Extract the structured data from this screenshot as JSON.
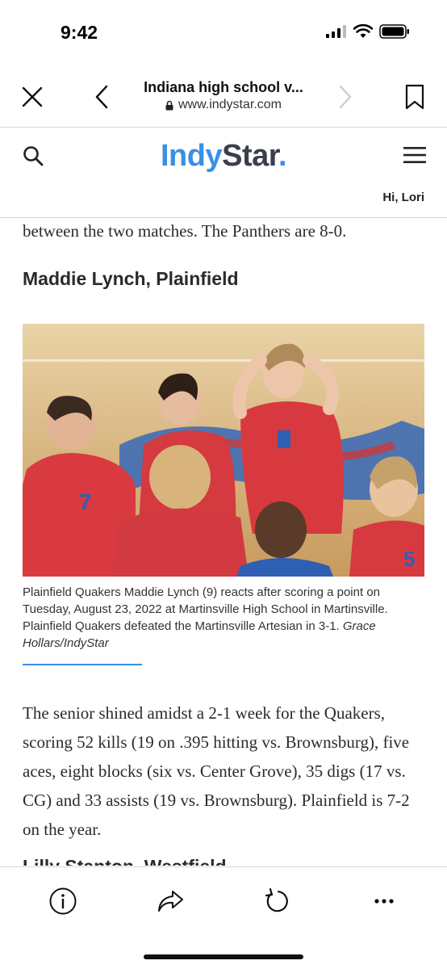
{
  "status": {
    "time": "9:42"
  },
  "browser": {
    "page_title": "Indiana high school v...",
    "host": "www.indystar.com",
    "icons": [
      "close-icon",
      "back-chevron-icon",
      "forward-chevron-icon",
      "bookmark-icon",
      "lock-icon"
    ]
  },
  "site": {
    "logo_part1": "Indy",
    "logo_part2": "Star",
    "logo_dot": ".",
    "greeting": "Hi, Lori",
    "colors": {
      "brand_blue": "#3a8fe6",
      "brand_dark": "#3a3f4a"
    }
  },
  "article": {
    "top_paragraph": "between the two matches. The Panthers are 8-0.",
    "subhead": "Maddie Lynch, Plainfield",
    "caption": "Plainfield Quakers Maddie Lynch (9) reacts after scoring a point on Tuesday, August 23, 2022 at Martinsville High School in Martinsville. Plainfield Quakers defeated the Martinsville Artesian in 3-1.",
    "credit": "Grace Hollars/IndyStar",
    "body_paragraph": "The senior shined amidst a 2-1 week for the Quakers, scoring 52 kills (19 on .395 hitting vs. Brownsburg), five aces, eight blocks (six vs. Center Grove), 35 digs (17 vs. CG) and 33 assists (19 vs. Brownsburg). Plainfield is 7-2 on the year.",
    "next_subhead": "Lilly Stanton, Westfield"
  },
  "toolbar": {
    "icons": [
      "info-icon",
      "share-icon",
      "reload-icon",
      "more-icon"
    ]
  }
}
